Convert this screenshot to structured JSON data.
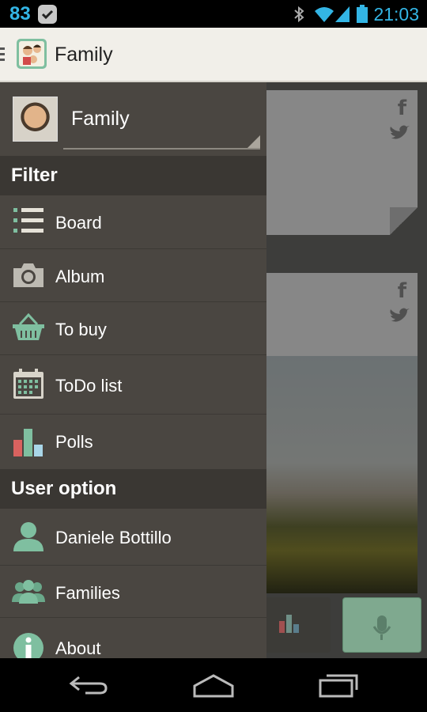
{
  "status_bar": {
    "notification_count": "83",
    "time": "21:03"
  },
  "action_bar": {
    "title": "Family",
    "logo_icon": "family-app-icon",
    "menu_icon": "drawer-indicator-icon"
  },
  "drawer": {
    "profile": {
      "name": "Family"
    },
    "sections": [
      {
        "title": "Filter",
        "items": [
          {
            "label": "Board",
            "icon": "board-list-icon"
          },
          {
            "label": "Album",
            "icon": "camera-icon"
          },
          {
            "label": "To buy",
            "icon": "basket-icon"
          },
          {
            "label": "ToDo list",
            "icon": "calendar-icon"
          },
          {
            "label": "Polls",
            "icon": "bar-chart-icon"
          }
        ]
      },
      {
        "title": "User option",
        "items": [
          {
            "label": "Daniele Bottillo",
            "icon": "user-icon"
          },
          {
            "label": "Families",
            "icon": "group-icon"
          },
          {
            "label": "About",
            "icon": "info-icon"
          }
        ]
      }
    ]
  },
  "colors": {
    "accent": "#33b5e5",
    "drawer_bg": "#4a4641",
    "section_bg": "#3a3733",
    "icon_green": "#7fbfa0"
  }
}
